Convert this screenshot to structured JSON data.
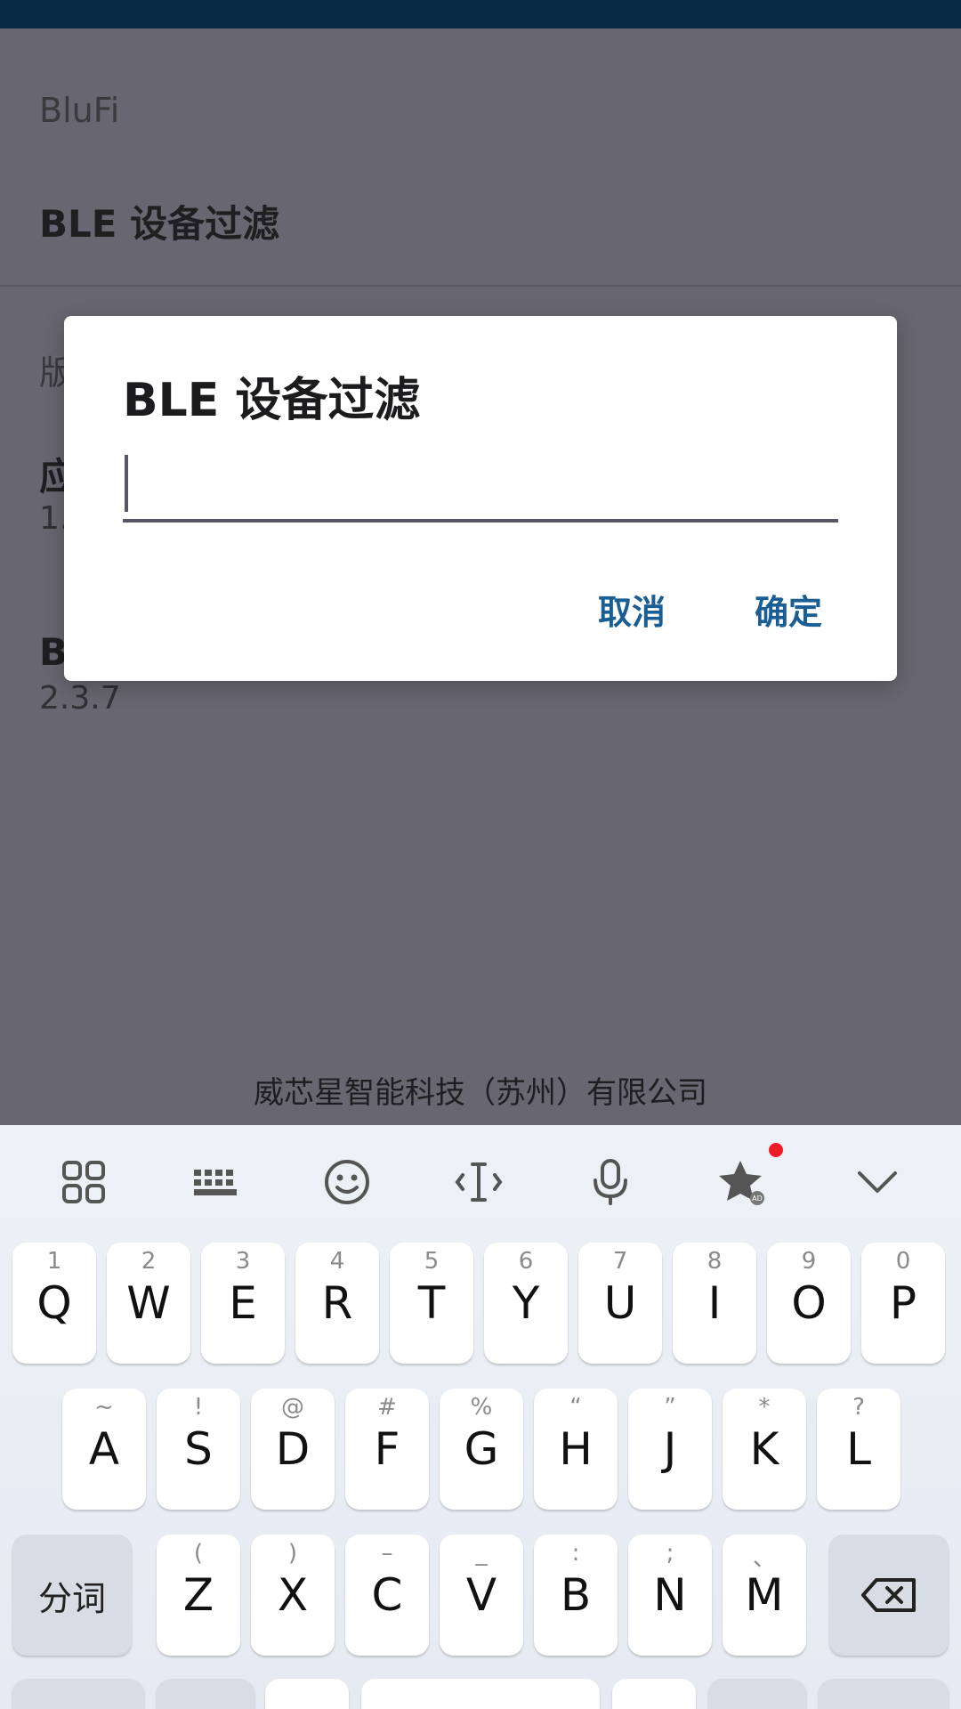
{
  "settings": {
    "category_app": "BluFi",
    "ble_filter_title": "BLE 设备过滤",
    "category_version_partial": "版",
    "app_version_title_partial": "应",
    "app_version_value_partial": "1.",
    "blufi_version_title_partial": "B",
    "blufi_version_value": "2.3.7",
    "footer": "威芯星智能科技（苏州）有限公司"
  },
  "dialog": {
    "title": "BLE 设备过滤",
    "input_value": "",
    "cancel_label": "取消",
    "ok_label": "确定"
  },
  "keyboard": {
    "toolbar_icons": [
      "apps-grid-icon",
      "keyboard-icon",
      "emoji-icon",
      "cursor-icon",
      "microphone-icon",
      "star-ad-icon",
      "collapse-chevron-icon"
    ],
    "row1": [
      {
        "main": "Q",
        "sub": "1"
      },
      {
        "main": "W",
        "sub": "2"
      },
      {
        "main": "E",
        "sub": "3"
      },
      {
        "main": "R",
        "sub": "4"
      },
      {
        "main": "T",
        "sub": "5"
      },
      {
        "main": "Y",
        "sub": "6"
      },
      {
        "main": "U",
        "sub": "7"
      },
      {
        "main": "I",
        "sub": "8"
      },
      {
        "main": "O",
        "sub": "9"
      },
      {
        "main": "P",
        "sub": "0"
      }
    ],
    "row2": [
      {
        "main": "A",
        "sub": "~"
      },
      {
        "main": "S",
        "sub": "!"
      },
      {
        "main": "D",
        "sub": "@"
      },
      {
        "main": "F",
        "sub": "#"
      },
      {
        "main": "G",
        "sub": "%"
      },
      {
        "main": "H",
        "sub": "“"
      },
      {
        "main": "J",
        "sub": "”"
      },
      {
        "main": "K",
        "sub": "*"
      },
      {
        "main": "L",
        "sub": "?"
      }
    ],
    "row3": [
      {
        "main": "Z",
        "sub": "("
      },
      {
        "main": "X",
        "sub": ")"
      },
      {
        "main": "C",
        "sub": "–"
      },
      {
        "main": "V",
        "sub": "_"
      },
      {
        "main": "B",
        "sub": ":"
      },
      {
        "main": "N",
        "sub": ";"
      },
      {
        "main": "M",
        "sub": "、"
      }
    ],
    "segment_label": "分词",
    "accent_dot_color": "#ee1c25"
  },
  "colors": {
    "status_bar": "#082a46",
    "dialog_button": "#1a5e94"
  }
}
